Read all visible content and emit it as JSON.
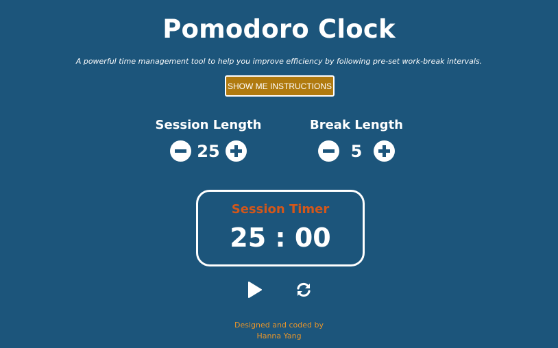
{
  "app": {
    "title": "Pomodoro Clock",
    "subtitle": "A powerful time management tool to help you improve efficiency by following pre-set work-break intervals."
  },
  "instructions_button": {
    "label": "SHOW ME INSTRUCTIONS"
  },
  "session": {
    "label": "Session Length",
    "value": "25",
    "decrement_icon": "minus-circle-icon",
    "increment_icon": "plus-circle-icon"
  },
  "break": {
    "label": "Break Length",
    "value": "5",
    "decrement_icon": "minus-circle-icon",
    "increment_icon": "plus-circle-icon"
  },
  "timer": {
    "label": "Session Timer",
    "value": "25 : 00"
  },
  "controls": {
    "play_icon": "play-icon",
    "reset_icon": "refresh-icon"
  },
  "footer": {
    "line1": "Designed and coded by",
    "line2": "Hanna Yang"
  },
  "colors": {
    "background": "#1c557b",
    "button": "#b07a0f",
    "timer_label": "#d4571a",
    "footer_text": "#e8952a",
    "foreground": "#ffffff"
  }
}
